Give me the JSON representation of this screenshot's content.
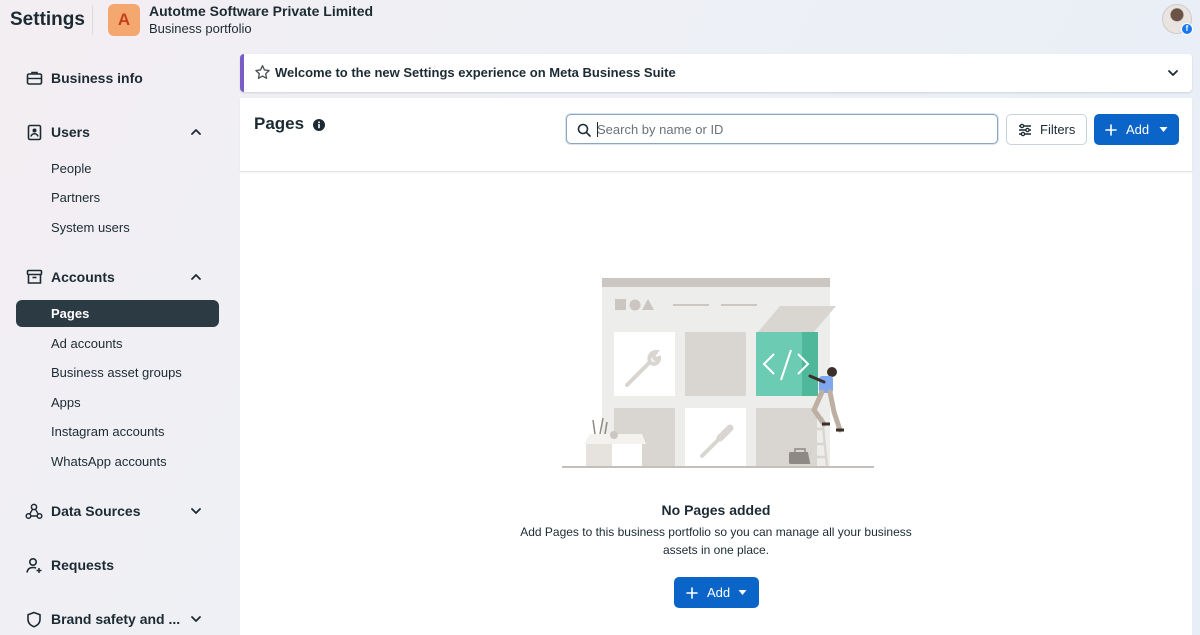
{
  "header": {
    "app_title": "Settings",
    "business_initial": "A",
    "business_name": "Autotme Software Private Limited",
    "business_subtitle": "Business portfolio"
  },
  "sidebar": {
    "sections": [
      {
        "label": "Business info",
        "icon": "briefcase-icon"
      },
      {
        "label": "Users",
        "icon": "id-badge-icon",
        "expanded": true,
        "items": [
          "People",
          "Partners",
          "System users"
        ]
      },
      {
        "label": "Accounts",
        "icon": "archive-box-icon",
        "expanded": true,
        "items": [
          "Pages",
          "Ad accounts",
          "Business asset groups",
          "Apps",
          "Instagram accounts",
          "WhatsApp accounts"
        ]
      },
      {
        "label": "Data Sources",
        "icon": "data-sources-icon",
        "expanded": false
      },
      {
        "label": "Requests",
        "icon": "person-request-icon"
      },
      {
        "label": "Brand safety and ...",
        "icon": "shield-icon",
        "expanded": false
      }
    ],
    "active_item": "Pages"
  },
  "banner": {
    "text": "Welcome to the new Settings experience on Meta Business Suite",
    "icon": "star-icon"
  },
  "main": {
    "title": "Pages",
    "search_placeholder": "Search by name or ID",
    "filters_label": "Filters",
    "add_label": "Add",
    "empty_title": "No Pages added",
    "empty_description": "Add Pages to this business portfolio so you can manage all your business assets in one place.",
    "empty_add_label": "Add"
  },
  "colors": {
    "primary_button": "#0b64c8",
    "active_nav": "#2c3a44",
    "banner_accent": "#7a5ec8",
    "avatar_bg": "#f4a86f",
    "illustration_teal": "#6ccbb3"
  }
}
